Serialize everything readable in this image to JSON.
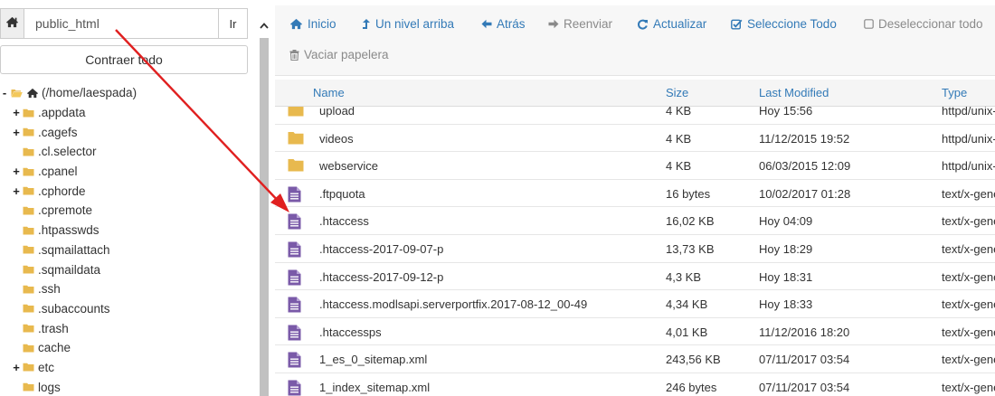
{
  "sidebar": {
    "path_value": "public_html",
    "go_label": "Ir",
    "collapse_label": "Contraer todo",
    "tree": [
      {
        "label": "(/home/laespada)",
        "toggle": "-",
        "kind": "root"
      },
      {
        "label": ".appdata",
        "toggle": "+",
        "kind": "folder"
      },
      {
        "label": ".cagefs",
        "toggle": "+",
        "kind": "folder"
      },
      {
        "label": ".cl.selector",
        "toggle": "",
        "kind": "folder"
      },
      {
        "label": ".cpanel",
        "toggle": "+",
        "kind": "folder"
      },
      {
        "label": ".cphorde",
        "toggle": "+",
        "kind": "folder"
      },
      {
        "label": ".cpremote",
        "toggle": "",
        "kind": "folder"
      },
      {
        "label": ".htpasswds",
        "toggle": "",
        "kind": "folder"
      },
      {
        "label": ".sqmailattach",
        "toggle": "",
        "kind": "folder"
      },
      {
        "label": ".sqmaildata",
        "toggle": "",
        "kind": "folder"
      },
      {
        "label": ".ssh",
        "toggle": "",
        "kind": "folder"
      },
      {
        "label": ".subaccounts",
        "toggle": "",
        "kind": "folder"
      },
      {
        "label": ".trash",
        "toggle": "",
        "kind": "folder"
      },
      {
        "label": "cache",
        "toggle": "",
        "kind": "folder"
      },
      {
        "label": "etc",
        "toggle": "+",
        "kind": "folder"
      },
      {
        "label": "logs",
        "toggle": "",
        "kind": "folder"
      }
    ]
  },
  "toolbar": {
    "home": "Inicio",
    "up": "Un nivel arriba",
    "back": "Atrás",
    "forward": "Reenviar",
    "reload": "Actualizar",
    "select_all": "Seleccione Todo",
    "deselect_all": "Deseleccionar todo",
    "empty_trash": "Vaciar papelera"
  },
  "table": {
    "columns": [
      "Name",
      "Size",
      "Last Modified",
      "Type"
    ],
    "rows": [
      {
        "name": "upload",
        "size": "4 KB",
        "modified": "Hoy 15:56",
        "type": "httpd/unix-directory",
        "kind": "folder"
      },
      {
        "name": "videos",
        "size": "4 KB",
        "modified": "11/12/2015 19:52",
        "type": "httpd/unix-directory",
        "kind": "folder"
      },
      {
        "name": "webservice",
        "size": "4 KB",
        "modified": "06/03/2015 12:09",
        "type": "httpd/unix-directory",
        "kind": "folder"
      },
      {
        "name": ".ftpquota",
        "size": "16 bytes",
        "modified": "10/02/2017 01:28",
        "type": "text/x-generic",
        "kind": "file"
      },
      {
        "name": ".htaccess",
        "size": "16,02 KB",
        "modified": "Hoy 04:09",
        "type": "text/x-generic",
        "kind": "file"
      },
      {
        "name": ".htaccess-2017-09-07-p",
        "size": "13,73 KB",
        "modified": "Hoy 18:29",
        "type": "text/x-generic",
        "kind": "file"
      },
      {
        "name": ".htaccess-2017-09-12-p",
        "size": "4,3 KB",
        "modified": "Hoy 18:31",
        "type": "text/x-generic",
        "kind": "file"
      },
      {
        "name": ".htaccess.modlsapi.serverportfix.2017-08-12_00-49",
        "size": "4,34 KB",
        "modified": "Hoy 18:33",
        "type": "text/x-generic",
        "kind": "file"
      },
      {
        "name": ".htaccessps",
        "size": "4,01 KB",
        "modified": "11/12/2016 18:20",
        "type": "text/x-generic",
        "kind": "file"
      },
      {
        "name": "1_es_0_sitemap.xml",
        "size": "243,56 KB",
        "modified": "07/11/2017 03:54",
        "type": "text/x-generic",
        "kind": "file"
      },
      {
        "name": "1_index_sitemap.xml",
        "size": "246 bytes",
        "modified": "07/11/2017 03:54",
        "type": "text/x-generic",
        "kind": "file"
      }
    ]
  },
  "colors": {
    "link": "#337ab7",
    "folder": "#e8b94e",
    "file": "#7a5aa8",
    "arrow": "#e02020"
  }
}
